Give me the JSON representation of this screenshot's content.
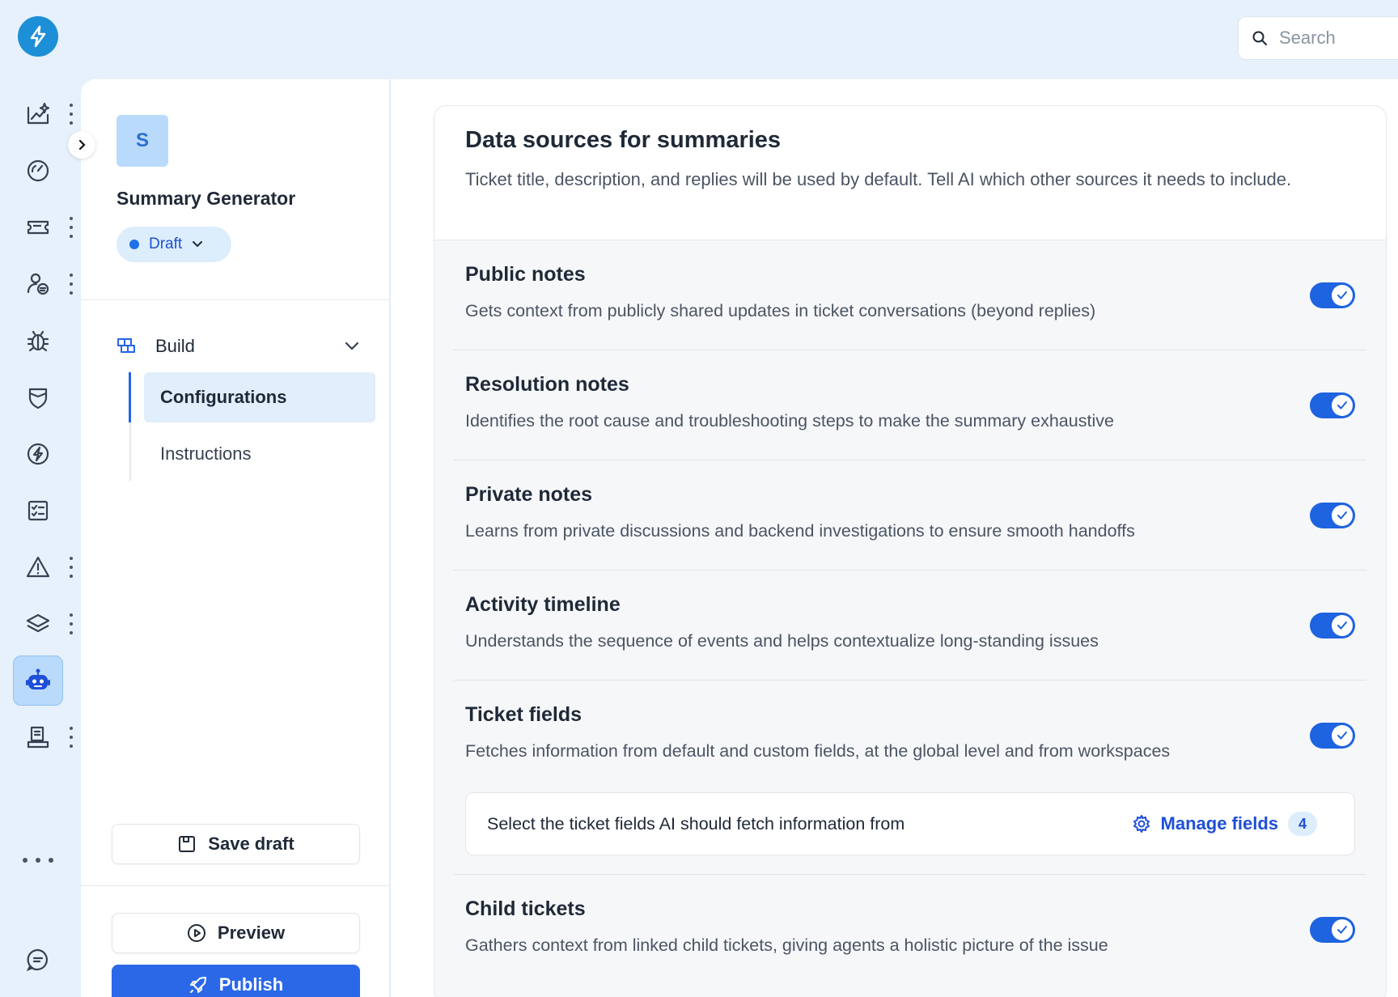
{
  "search": {
    "placeholder": "Search"
  },
  "rail": {
    "icons": [
      "analytics-sparkle-icon",
      "dashboard-gauge-icon",
      "ticket-icon",
      "contacts-icon",
      "bug-icon",
      "shield-icon",
      "bolt-circle-icon",
      "checklist-icon",
      "warning-icon",
      "layers-icon",
      "bot-icon",
      "knowledge-icon",
      "more-icon",
      "chat-icon"
    ],
    "active": "bot-icon"
  },
  "agent": {
    "avatar_letter": "S",
    "name": "Summary Generator",
    "status": "Draft"
  },
  "nav": {
    "section": "Build",
    "items": [
      "Configurations",
      "Instructions"
    ],
    "active": "Configurations"
  },
  "actions": {
    "save_draft": "Save draft",
    "preview": "Preview",
    "publish": "Publish"
  },
  "main": {
    "title": "Data sources for summaries",
    "description": "Ticket title, description, and replies will be used by default. Tell AI which other sources it needs to include.",
    "sources": [
      {
        "title": "Public notes",
        "desc": "Gets context from publicly shared updates in ticket conversations (beyond replies)",
        "enabled": true
      },
      {
        "title": "Resolution notes",
        "desc": "Identifies the root cause and troubleshooting steps to make the summary exhaustive",
        "enabled": true
      },
      {
        "title": "Private notes",
        "desc": "Learns from private discussions and backend investigations to ensure smooth handoffs",
        "enabled": true
      },
      {
        "title": "Activity timeline",
        "desc": "Understands the sequence of events and helps contextualize long-standing issues",
        "enabled": true
      },
      {
        "title": "Ticket fields",
        "desc": "Fetches information from default and custom fields, at the global level and from workspaces",
        "enabled": true
      },
      {
        "title": "Child tickets",
        "desc": "Gathers context from linked child tickets, giving agents a holistic picture of the issue",
        "enabled": true
      }
    ],
    "ticket_fields_box": {
      "text": "Select the ticket fields AI should fetch information from",
      "manage_label": "Manage fields",
      "count": "4"
    }
  },
  "colors": {
    "accent": "#2a68e8",
    "rail_bg": "#e6f1fb",
    "logo": "#1d8fd7"
  }
}
